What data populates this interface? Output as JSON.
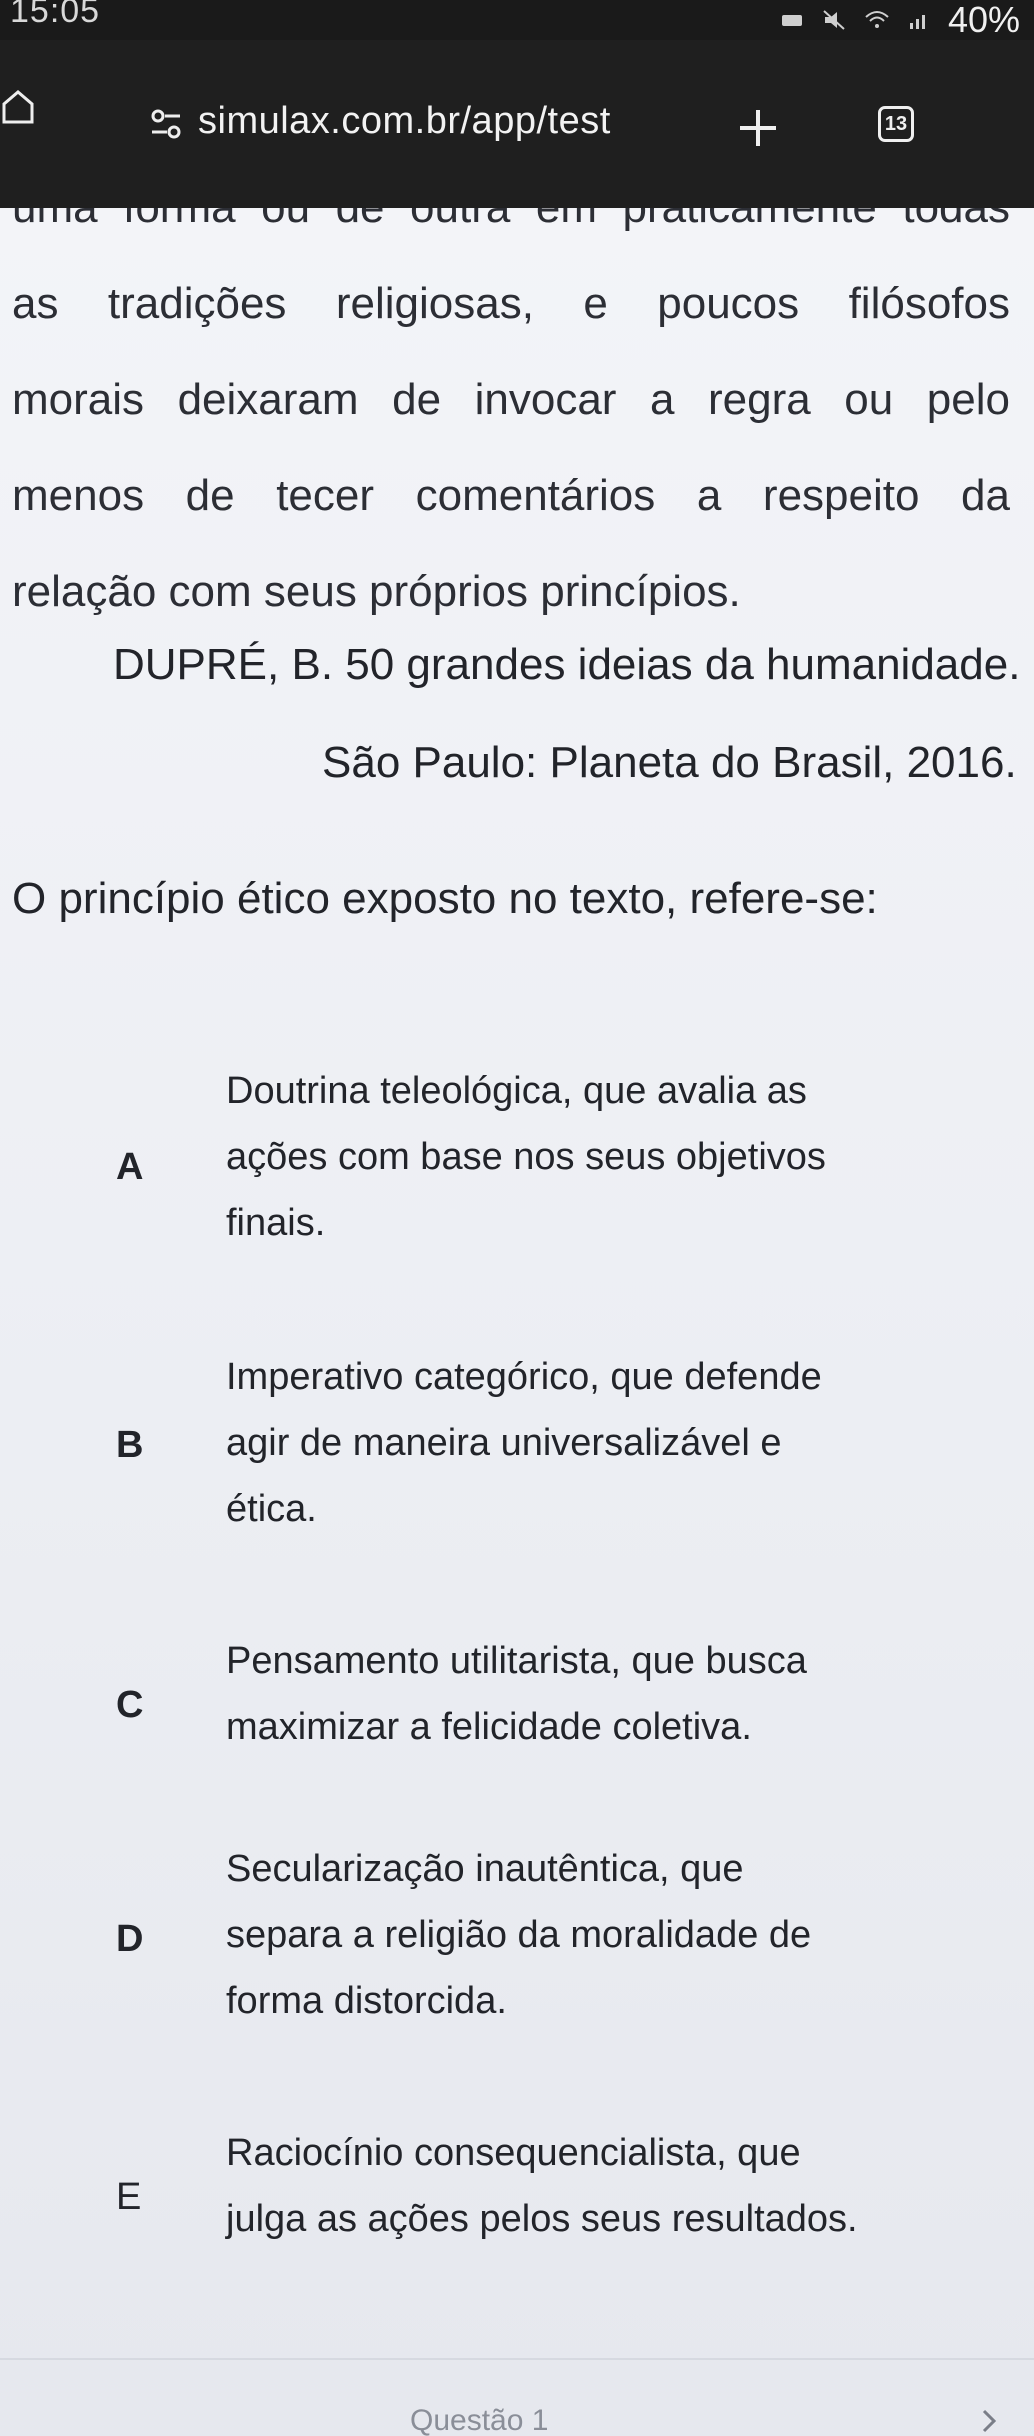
{
  "status_bar": {
    "time": "15:05",
    "battery": "40%"
  },
  "browser": {
    "url": "simulax.com.br/app/test",
    "tab_count": "13"
  },
  "passage": {
    "lines": [
      "uma forma ou de outra em praticamente todas",
      "as tradições religiosas, e poucos filósofos",
      "morais deixaram de invocar a regra ou pelo",
      "menos de tecer comentários a respeito da",
      "relação com seus próprios princípios."
    ],
    "citation_author": "DUPRÉ, B. 50 grandes ideias da humanidade.",
    "citation_publisher": "São Paulo: Planeta do Brasil, 2016."
  },
  "question": {
    "prompt": "O princípio ético exposto no texto, refere-se:",
    "options": [
      {
        "letter": "A",
        "lines": [
          "Doutrina teleológica, que avalia as",
          "ações com base nos seus objetivos",
          "finais."
        ]
      },
      {
        "letter": "B",
        "lines": [
          "Imperativo categórico, que defende",
          "agir de maneira universalizável e",
          "ética."
        ]
      },
      {
        "letter": "C",
        "lines": [
          "Pensamento utilitarista, que busca",
          "maximizar a felicidade coletiva."
        ]
      },
      {
        "letter": "D",
        "lines": [
          "Secularização inautêntica, que",
          "separa a religião da moralidade de",
          "forma distorcida."
        ]
      },
      {
        "letter": "E",
        "lines": [
          "Raciocínio consequencialista, que",
          "julga as ações pelos seus resultados."
        ]
      }
    ]
  },
  "footer": {
    "question_label": "Questão 1"
  },
  "icons": {
    "home": "home-icon",
    "site_settings": "tune-icon",
    "new_tab": "plus-icon",
    "next": "chevron-right-icon"
  },
  "colors": {
    "status_bar_bg": "#1a1a1a",
    "url_bar_bg": "#1f1f1f",
    "page_bg": "#eef0f5",
    "text": "#22242a"
  }
}
